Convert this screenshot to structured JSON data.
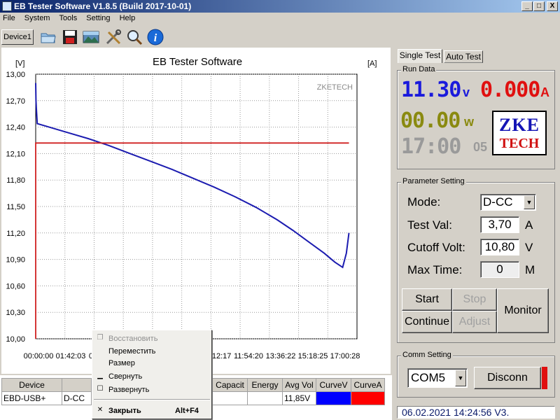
{
  "window": {
    "title": "EB Tester Software V1.8.5 (Build 2017-10-01)",
    "minimize": "_",
    "maximize": "□",
    "close": "X"
  },
  "menu": [
    "File",
    "System",
    "Tools",
    "Setting",
    "Help"
  ],
  "toolbar": {
    "device_tab": "Device1",
    "buttons": [
      "open-icon",
      "save-icon",
      "picture-icon",
      "tools-icon",
      "zoom-icon",
      "info-icon"
    ]
  },
  "chart_data": {
    "type": "line",
    "title": "EB Tester Software",
    "watermark": "ZKETECH",
    "ylabel_left": "[V]",
    "ylabel_right": "[A]",
    "ylim": [
      10.0,
      13.0
    ],
    "yticks": [
      "13,00",
      "12,70",
      "12,40",
      "12,10",
      "11,80",
      "11,50",
      "11,20",
      "10,90",
      "10,60",
      "10,30",
      "10,00"
    ],
    "xticks": [
      "00:00:00",
      "01:42:03",
      "03",
      "10:12:17",
      "11:54:20",
      "13:36:22",
      "15:18:25",
      "17:00:28"
    ],
    "xlim_seconds": [
      0,
      61228
    ],
    "series": [
      {
        "name": "CurveV",
        "color": "#1c1cb0",
        "points": [
          [
            0,
            12.9
          ],
          [
            60,
            12.7
          ],
          [
            120,
            12.62
          ],
          [
            300,
            12.44
          ],
          [
            2000,
            12.41
          ],
          [
            6000,
            12.34
          ],
          [
            10000,
            12.27
          ],
          [
            14000,
            12.19
          ],
          [
            18000,
            12.1
          ],
          [
            22000,
            12.01
          ],
          [
            26000,
            11.92
          ],
          [
            30000,
            11.82
          ],
          [
            34000,
            11.72
          ],
          [
            38000,
            11.61
          ],
          [
            42000,
            11.49
          ],
          [
            46000,
            11.35
          ],
          [
            49000,
            11.23
          ],
          [
            52000,
            11.1
          ],
          [
            55000,
            10.97
          ],
          [
            57000,
            10.87
          ],
          [
            58500,
            10.81
          ],
          [
            59200,
            10.97
          ],
          [
            59700,
            11.2
          ]
        ]
      },
      {
        "name": "CurveA",
        "color": "#d02020",
        "points": [
          [
            0,
            10.0
          ],
          [
            0,
            12.22
          ],
          [
            59700,
            12.22
          ]
        ]
      }
    ]
  },
  "table": {
    "headers": [
      "Device",
      "",
      "",
      "",
      "",
      "",
      "",
      "Capacit",
      "Energy",
      "Avg Vol",
      "CurveV",
      "CurveA"
    ],
    "row": [
      "EBD-USB+",
      "D-CC",
      "",
      "",
      "",
      "",
      "",
      "",
      "",
      "11,85V",
      "",
      ""
    ]
  },
  "context_menu": {
    "items": [
      {
        "label": "Восстановить",
        "icon": "restore-icon",
        "glyph": "❐",
        "disabled": true
      },
      {
        "label": "Переместить",
        "icon": "",
        "glyph": "",
        "disabled": false
      },
      {
        "label": "Размер",
        "icon": "",
        "glyph": "",
        "disabled": false
      },
      {
        "label": "Свернуть",
        "icon": "minimize-icon",
        "glyph": "▁",
        "disabled": false
      },
      {
        "label": "Развернуть",
        "icon": "maximize-icon",
        "glyph": "☐",
        "disabled": false
      }
    ],
    "close": {
      "label": "Закрыть",
      "shortcut": "Alt+F4",
      "glyph": "✕"
    }
  },
  "tabs": {
    "single": "Single Test",
    "auto": "Auto Test"
  },
  "run_data": {
    "title": "Run Data",
    "voltage": "11.30",
    "voltage_unit": "v",
    "current": "0.000",
    "current_unit": "A",
    "power": "00.00",
    "power_unit": "w",
    "time": "17:00",
    "time_unit": "05",
    "logo_top": "ZKE",
    "logo_bottom": "TECH"
  },
  "params": {
    "title": "Parameter Setting",
    "mode_label": "Mode:",
    "mode_value": "D-CC",
    "test_val_label": "Test Val:",
    "test_val": "3,70",
    "test_val_unit": "A",
    "cutoff_label": "Cutoff Volt:",
    "cutoff_val": "10,80",
    "cutoff_unit": "V",
    "max_time_label": "Max Time:",
    "max_time_val": "0",
    "max_time_unit": "M"
  },
  "controls": {
    "start": "Start",
    "stop": "Stop",
    "continue": "Continue",
    "adjust": "Adjust",
    "monitor": "Monitor"
  },
  "comm": {
    "title": "Comm Setting",
    "port": "COM5",
    "disconnect": "Disconn"
  },
  "status": "06.02.2021 14:24:56  V3."
}
